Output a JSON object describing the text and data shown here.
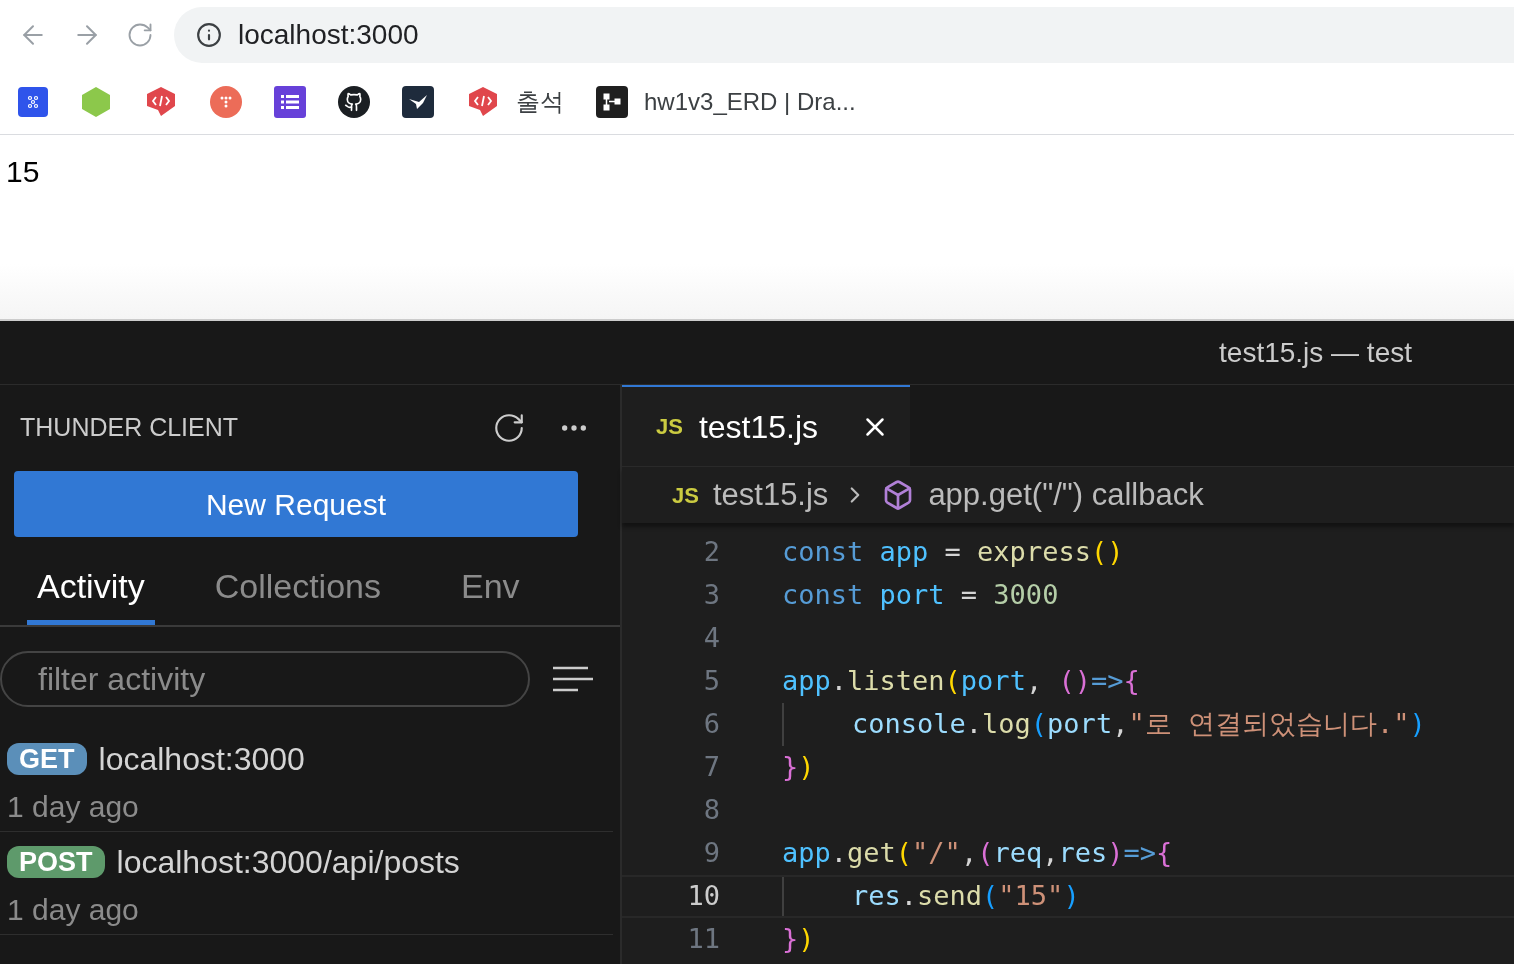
{
  "browser": {
    "url": "localhost:3000",
    "bookmarks": [
      {
        "kind": "grid-dots",
        "color": "#2f54eb"
      },
      {
        "kind": "node",
        "color": "#8cc84b"
      },
      {
        "kind": "code-bubble",
        "color": "#e0474c"
      },
      {
        "kind": "dots-circle",
        "color": "#ec6c58"
      },
      {
        "kind": "list",
        "color": "#6741d9"
      },
      {
        "kind": "github",
        "color": "#1b1f23"
      },
      {
        "kind": "bird",
        "color": "#1e2b3c"
      },
      {
        "kind": "code-bubble",
        "color": "#e0474c",
        "label": "출석"
      },
      {
        "kind": "flow",
        "color": "#1f1f1f",
        "label": "hw1v3_ERD | Dra..."
      }
    ]
  },
  "page": {
    "text": "15"
  },
  "vscode": {
    "title": "test15.js — test",
    "sidebar": {
      "title": "THUNDER CLIENT",
      "new_request": "New Request",
      "tabs": [
        {
          "label": "Activity",
          "selected": true
        },
        {
          "label": "Collections",
          "selected": false
        },
        {
          "label": "Env",
          "selected": false
        }
      ],
      "filter": {
        "placeholder": "filter activity"
      },
      "requests": [
        {
          "method": "GET",
          "color": "#5b8fb9",
          "url": "localhost:3000",
          "time": "1 day ago"
        },
        {
          "method": "POST",
          "color": "#5e9a6b",
          "url": "localhost:3000/api/posts",
          "time": "1 day ago"
        }
      ]
    },
    "editor": {
      "tab": {
        "icon": "JS",
        "name": "test15.js"
      },
      "breadcrumb": {
        "icon": "JS",
        "file": "test15.js",
        "symbol": "app.get(\"/\") callback"
      },
      "lines": [
        {
          "number": "2",
          "current": false,
          "indented": false,
          "tokens": [
            {
              "kind": "keyword",
              "text": "const "
            },
            {
              "kind": "const",
              "text": "app"
            },
            {
              "kind": "plain",
              "text": " = "
            },
            {
              "kind": "function",
              "text": "express"
            },
            {
              "kind": "bracket1",
              "text": "()"
            }
          ]
        },
        {
          "number": "3",
          "current": false,
          "indented": false,
          "tokens": [
            {
              "kind": "keyword",
              "text": "const "
            },
            {
              "kind": "const",
              "text": "port"
            },
            {
              "kind": "plain",
              "text": " = "
            },
            {
              "kind": "number",
              "text": "3000"
            }
          ]
        },
        {
          "number": "4",
          "current": false
        },
        {
          "number": "5",
          "current": false,
          "indented": false,
          "tokens": [
            {
              "kind": "const",
              "text": "app"
            },
            {
              "kind": "plain",
              "text": "."
            },
            {
              "kind": "function",
              "text": "listen"
            },
            {
              "kind": "bracket1",
              "text": "("
            },
            {
              "kind": "const",
              "text": "port"
            },
            {
              "kind": "plain",
              "text": ", "
            },
            {
              "kind": "bracket2",
              "text": "()"
            },
            {
              "kind": "keyword",
              "text": "=>"
            },
            {
              "kind": "bracket2",
              "text": "{"
            }
          ]
        },
        {
          "number": "6",
          "current": false,
          "indented": true,
          "tokens": [
            {
              "kind": "variable",
              "text": "console"
            },
            {
              "kind": "plain",
              "text": "."
            },
            {
              "kind": "function",
              "text": "log"
            },
            {
              "kind": "bracket3",
              "text": "("
            },
            {
              "kind": "variable",
              "text": "port"
            },
            {
              "kind": "plain",
              "text": ","
            },
            {
              "kind": "string",
              "text": "\"로 연결되었습니다.\""
            },
            {
              "kind": "bracket3",
              "text": ")"
            }
          ]
        },
        {
          "number": "7",
          "current": false,
          "indented": false,
          "tokens": [
            {
              "kind": "bracket2",
              "text": "}"
            },
            {
              "kind": "bracket1",
              "text": ")"
            }
          ]
        },
        {
          "number": "8",
          "current": false
        },
        {
          "number": "9",
          "current": false,
          "indented": false,
          "tokens": [
            {
              "kind": "const",
              "text": "app"
            },
            {
              "kind": "plain",
              "text": "."
            },
            {
              "kind": "function",
              "text": "get"
            },
            {
              "kind": "bracket1",
              "text": "("
            },
            {
              "kind": "string",
              "text": "\"/\""
            },
            {
              "kind": "plain",
              "text": ","
            },
            {
              "kind": "bracket2",
              "text": "("
            },
            {
              "kind": "variable",
              "text": "req"
            },
            {
              "kind": "plain",
              "text": ","
            },
            {
              "kind": "variable",
              "text": "res"
            },
            {
              "kind": "bracket2",
              "text": ")"
            },
            {
              "kind": "keyword",
              "text": "=>"
            },
            {
              "kind": "bracket2",
              "text": "{"
            }
          ]
        },
        {
          "number": "10",
          "current": true,
          "indented": true,
          "tokens": [
            {
              "kind": "variable",
              "text": "res"
            },
            {
              "kind": "plain",
              "text": "."
            },
            {
              "kind": "function",
              "text": "send"
            },
            {
              "kind": "bracket3",
              "text": "("
            },
            {
              "kind": "string",
              "text": "\"15\""
            },
            {
              "kind": "bracket3",
              "text": ")"
            }
          ]
        },
        {
          "number": "11",
          "current": false,
          "indented": false,
          "tokens": [
            {
              "kind": "bracket2",
              "text": "}"
            },
            {
              "kind": "bracket1",
              "text": ")"
            }
          ]
        }
      ]
    }
  }
}
